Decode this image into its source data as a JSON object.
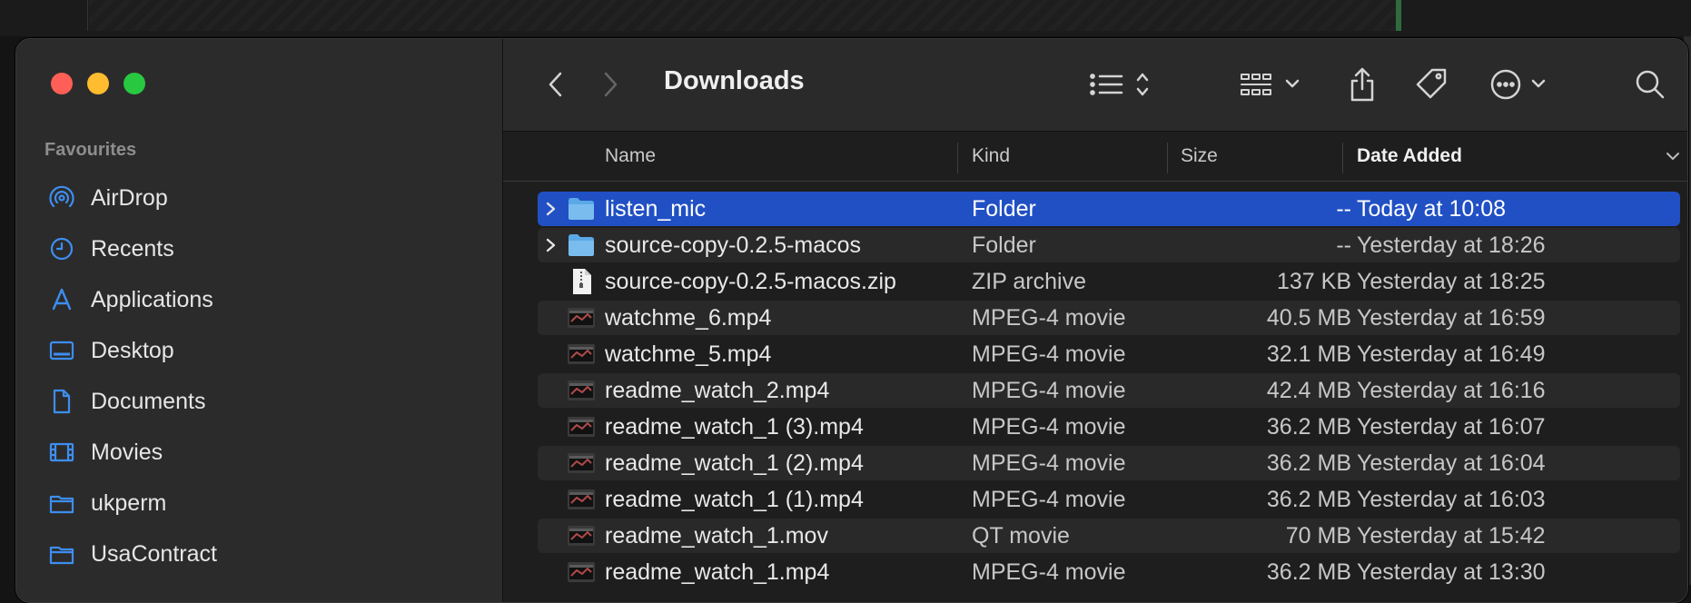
{
  "window": {
    "title": "Downloads"
  },
  "sidebar": {
    "section": "Favourites",
    "items": [
      {
        "label": "AirDrop",
        "icon": "airdrop-icon"
      },
      {
        "label": "Recents",
        "icon": "clock-icon"
      },
      {
        "label": "Applications",
        "icon": "applications-icon"
      },
      {
        "label": "Desktop",
        "icon": "desktop-icon"
      },
      {
        "label": "Documents",
        "icon": "document-icon"
      },
      {
        "label": "Movies",
        "icon": "film-icon"
      },
      {
        "label": "ukperm",
        "icon": "folder-icon"
      },
      {
        "label": "UsaContract",
        "icon": "folder-icon"
      }
    ]
  },
  "columns": {
    "name": "Name",
    "kind": "Kind",
    "size": "Size",
    "date": "Date Added"
  },
  "files": [
    {
      "name": "listen_mic",
      "kind": "Folder",
      "size": "--",
      "date": "Today at 10:08",
      "type": "folder",
      "selected": true
    },
    {
      "name": "source-copy-0.2.5-macos",
      "kind": "Folder",
      "size": "--",
      "date": "Yesterday at 18:26",
      "type": "folder"
    },
    {
      "name": "source-copy-0.2.5-macos.zip",
      "kind": "ZIP archive",
      "size": "137 KB",
      "date": "Yesterday at 18:25",
      "type": "zip"
    },
    {
      "name": "watchme_6.mp4",
      "kind": "MPEG-4 movie",
      "size": "40.5 MB",
      "date": "Yesterday at 16:59",
      "type": "video"
    },
    {
      "name": "watchme_5.mp4",
      "kind": "MPEG-4 movie",
      "size": "32.1 MB",
      "date": "Yesterday at 16:49",
      "type": "video"
    },
    {
      "name": "readme_watch_2.mp4",
      "kind": "MPEG-4 movie",
      "size": "42.4 MB",
      "date": "Yesterday at 16:16",
      "type": "video"
    },
    {
      "name": "readme_watch_1 (3).mp4",
      "kind": "MPEG-4 movie",
      "size": "36.2 MB",
      "date": "Yesterday at 16:07",
      "type": "video"
    },
    {
      "name": "readme_watch_1 (2).mp4",
      "kind": "MPEG-4 movie",
      "size": "36.2 MB",
      "date": "Yesterday at 16:04",
      "type": "video"
    },
    {
      "name": "readme_watch_1 (1).mp4",
      "kind": "MPEG-4 movie",
      "size": "36.2 MB",
      "date": "Yesterday at 16:03",
      "type": "video"
    },
    {
      "name": "readme_watch_1.mov",
      "kind": "QT movie",
      "size": "70 MB",
      "date": "Yesterday at 15:42",
      "type": "video"
    },
    {
      "name": "readme_watch_1.mp4",
      "kind": "MPEG-4 movie",
      "size": "36.2 MB",
      "date": "Yesterday at 13:30",
      "type": "video"
    }
  ],
  "colors": {
    "selection": "#2150c4",
    "folder": "#5aa9e6",
    "accent_icon": "#3d8ef0"
  }
}
